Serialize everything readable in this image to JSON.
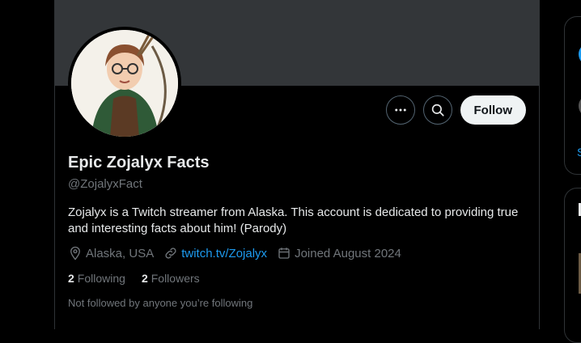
{
  "profile": {
    "display_name": "Epic Zojalyx Facts",
    "handle": "@ZojalyxFact",
    "bio": "Zojalyx is a Twitch streamer from Alaska. This account is dedicated to providing true and interesting facts about him! (Parody)",
    "location": "Alaska, USA",
    "website": "twitch.tv/Zojalyx",
    "joined": "Joined August 2024",
    "following_count": "2",
    "following_label": "Following",
    "followers_count": "2",
    "followers_label": "Followers",
    "not_followed_text": "Not followed by anyone you’re following"
  },
  "actions": {
    "follow_label": "Follow",
    "more_icon": "more-icon",
    "search_icon": "search-icon"
  },
  "colors": {
    "background": "#000000",
    "banner": "#333639",
    "link": "#1d9bf0",
    "muted": "#71767b",
    "border": "#2f3336"
  }
}
